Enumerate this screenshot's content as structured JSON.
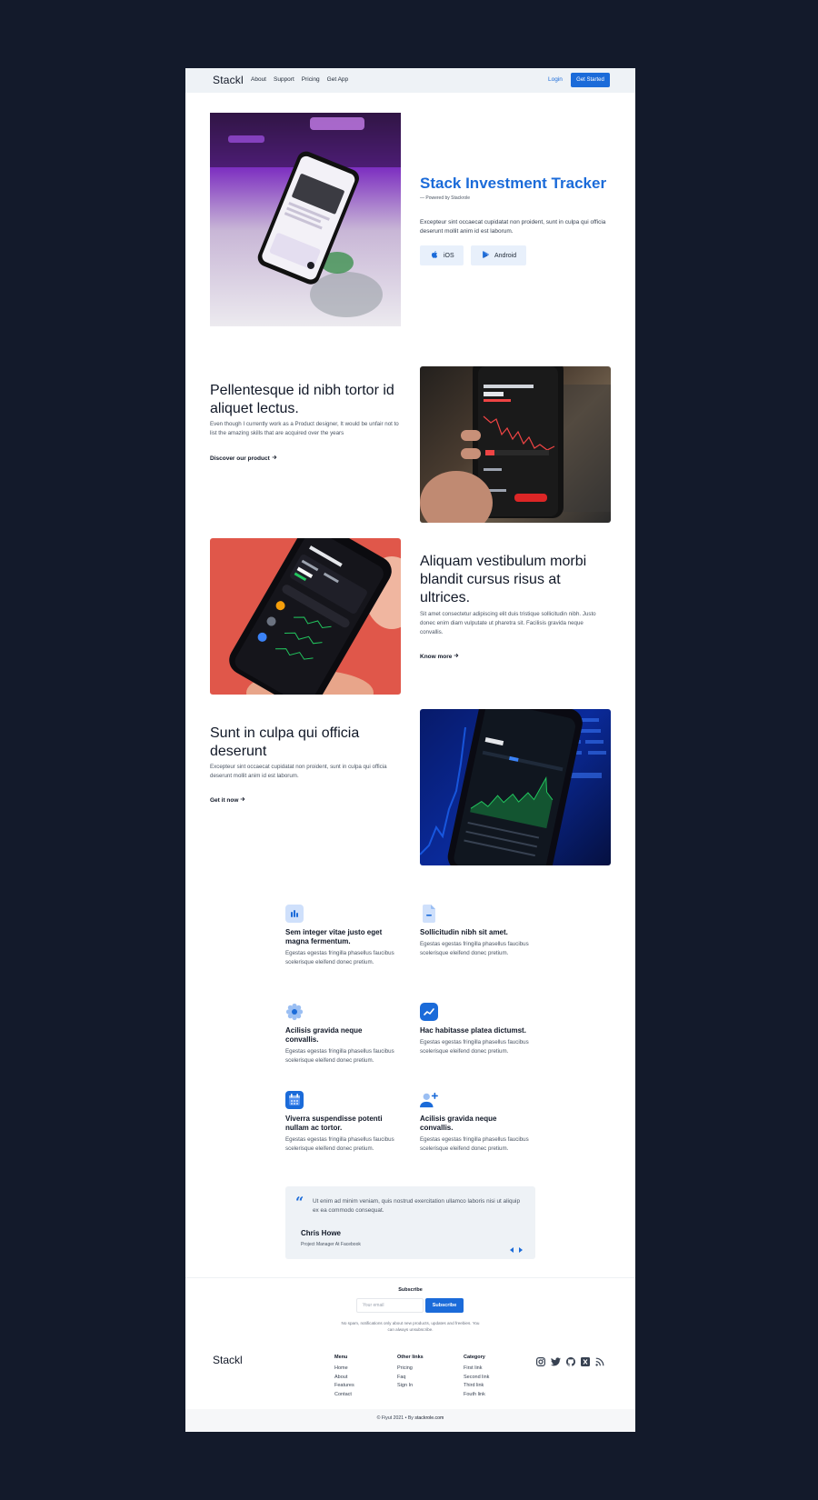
{
  "brand": {
    "name": "Stackl",
    "accent": "#1b6bd9",
    "background": "#131a2b"
  },
  "nav": {
    "links": [
      "About",
      "Support",
      "Pricing",
      "Get App"
    ],
    "login": "Login",
    "cta": "Get Started"
  },
  "hero": {
    "title": "Stack Investment Tracker",
    "powered": "— Powered by Stackrole",
    "description": "Excepteur sint occaecat cupidatat non proident, sunt in culpa qui officia deserunt mollit anim id est laborum.",
    "ios_label": "iOS",
    "android_label": "Android"
  },
  "sections": [
    {
      "title": "Pellentesque id nibh tortor id aliquet lectus.",
      "description": "Even though I currently work as a Product designer, It would be unfair not to list the amazing skills that are acquired over the years",
      "link": "Discover our product",
      "image_icon": "amc-stock-phone-image"
    },
    {
      "title": "Aliquam vestibulum morbi blandit cursus risus at ultrices.",
      "description": "Sit amet consectetur adipiscing elit duis tristique sollicitudin nibh. Justo donec enim diam vulputate ut pharetra sit. Facilisis gravida neque convallis.",
      "link": "Know more",
      "image_icon": "crypto-prices-phone-image"
    },
    {
      "title": "Sunt in culpa qui officia deserunt",
      "description": "Excepteur sint occaecat cupidatat non proident, sunt in culpa qui officia deserunt mollit anim id est laborum.",
      "link": "Get it now",
      "image_icon": "coin-chart-phone-image"
    }
  ],
  "features": [
    {
      "icon": "bar-chart-icon",
      "title": "Sem integer vitae justo eget magna fermentum.",
      "description": "Egestas egestas fringilla phasellus faucibus scelerisque eleifend donec pretium."
    },
    {
      "icon": "document-icon",
      "title": "Sollicitudin nibh sit amet.",
      "description": "Egestas egestas fringilla phasellus faucibus scelerisque eleifend donec pretium."
    },
    {
      "icon": "gear-icon",
      "title": "Acilisis gravida neque convallis.",
      "description": "Egestas egestas fringilla phasellus faucibus scelerisque eleifend donec pretium."
    },
    {
      "icon": "trend-icon",
      "title": "Hac habitasse platea dictumst.",
      "description": "Egestas egestas fringilla phasellus faucibus scelerisque eleifend donec pretium."
    },
    {
      "icon": "calendar-icon",
      "title": "Viverra suspendisse potenti nullam ac tortor.",
      "description": "Egestas egestas fringilla phasellus faucibus scelerisque eleifend donec pretium."
    },
    {
      "icon": "add-user-icon",
      "title": "Acilisis gravida neque convallis.",
      "description": "Egestas egestas fringilla phasellus faucibus scelerisque eleifend donec pretium."
    }
  ],
  "testimonial": {
    "quote": "Ut enim ad minim veniam, quis nostrud exercitation ullamco laboris nisi ut aliquip ex ea commodo consequat.",
    "name": "Chris Howe",
    "role": "Project Manager At Facebook"
  },
  "subscribe": {
    "title": "Subscribe",
    "placeholder": "Your email",
    "button": "Subscribe",
    "note": "No spam, notifications only about new products, updates and freebies. You can always unsubscribe."
  },
  "footer": {
    "columns": [
      {
        "heading": "Menu",
        "links": [
          "Home",
          "About",
          "Features",
          "Contact"
        ]
      },
      {
        "heading": "Other links",
        "links": [
          "Pricing",
          "Faq",
          "Sign In"
        ]
      },
      {
        "heading": "Category",
        "links": [
          "First link",
          "Second link",
          "Third link",
          "Fouth link"
        ]
      }
    ],
    "socials": [
      "instagram-icon",
      "twitter-icon",
      "github-icon",
      "xing-icon",
      "rss-icon"
    ],
    "copyright": "© Fiyut 2021 • By",
    "by_link": "stackrole.com"
  }
}
